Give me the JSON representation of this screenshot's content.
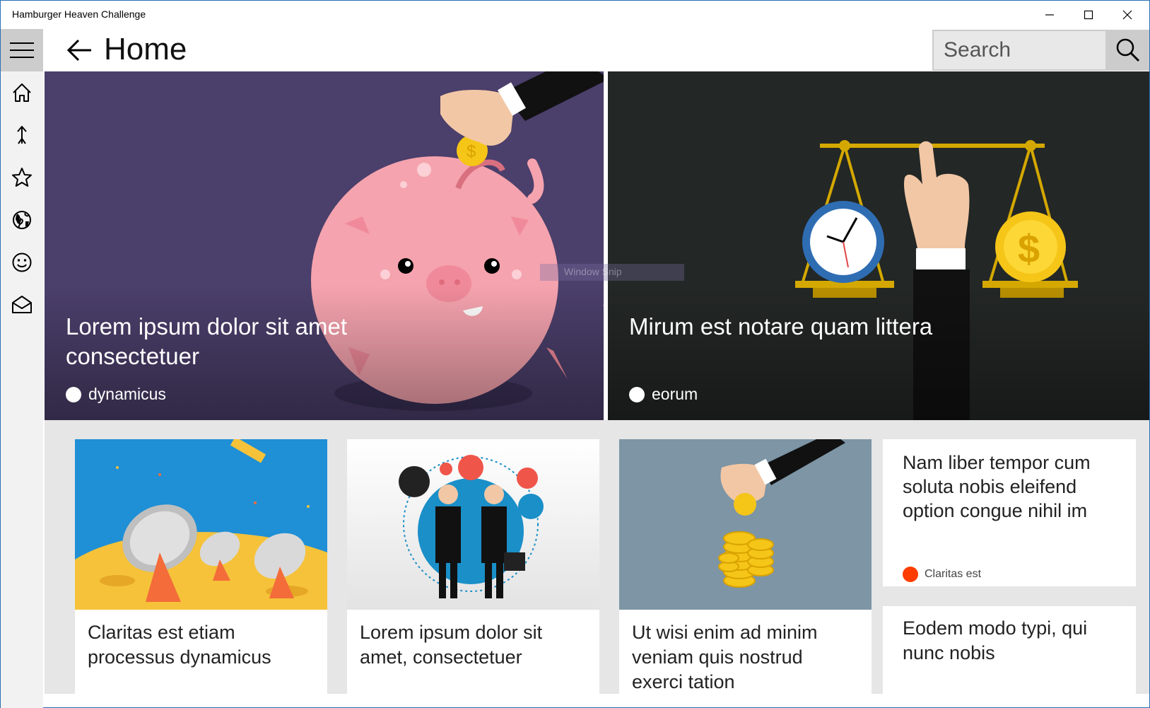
{
  "window": {
    "title": "Hamburger Heaven Challenge"
  },
  "nav": {
    "items": [
      {
        "icon": "home-icon"
      },
      {
        "icon": "arrow-up-icon"
      },
      {
        "icon": "star-icon"
      },
      {
        "icon": "globe-icon"
      },
      {
        "icon": "smiley-icon"
      },
      {
        "icon": "mail-icon"
      }
    ]
  },
  "header": {
    "title": "Home",
    "search_placeholder": "Search"
  },
  "hero": [
    {
      "title": "Lorem ipsum dolor sit amet consectetuer",
      "tag": "dynamicus",
      "tag_color": "#ffffff",
      "bg": "#4b3f6b"
    },
    {
      "title": "Mirum est notare quam littera",
      "tag": "eorum",
      "tag_color": "#ffffff",
      "bg": "#232725"
    }
  ],
  "cards": [
    {
      "title": "Claritas est etiam processus dynamicus"
    },
    {
      "title": "Lorem ipsum dolor sit amet, consectetuer"
    },
    {
      "title": "Ut wisi enim ad minim veniam quis nostrud exerci tation"
    },
    {
      "title": "Nam liber tempor cum soluta nobis eleifend option congue nihil im",
      "tag": "Claritas est",
      "tag_color": "#ff3d00"
    },
    {
      "title": "Eodem modo typi, qui nunc nobis"
    }
  ],
  "overlay": {
    "snip_label": "Window Snip"
  },
  "colors": {
    "accent_border": "#2b6fb6",
    "rail_bg": "#f2f2f2",
    "rail_active": "#cccccc"
  }
}
